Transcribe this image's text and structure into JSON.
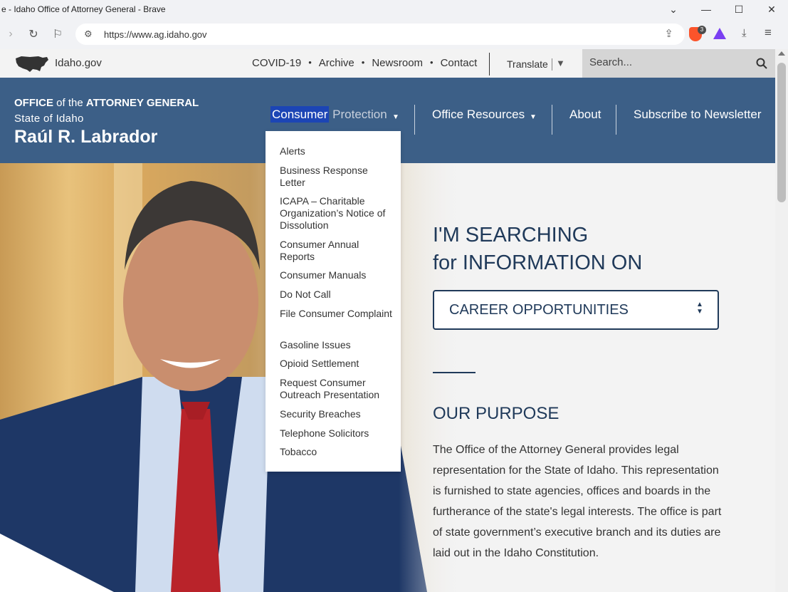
{
  "browser": {
    "window_title": "e - Idaho Office of Attorney General - Brave",
    "url": "https://www.ag.idaho.gov",
    "brave_badge_count": "3"
  },
  "utility_bar": {
    "idaho_link": "Idaho.gov",
    "links": [
      "COVID-19",
      "Archive",
      "Newsroom",
      "Contact"
    ],
    "separator": "•",
    "translate": "Translate",
    "search_placeholder": "Search..."
  },
  "header": {
    "org_line1_bold1": "OFFICE",
    "org_line1_mid": " of the ",
    "org_line1_bold2": "ATTORNEY GENERAL",
    "org_line2": "State of Idaho",
    "ag_name": "Raúl R. Labrador"
  },
  "nav": {
    "consumer_highlight": "Consumer",
    "consumer_rest": " Protection",
    "office_resources": "Office Resources",
    "about": "About",
    "subscribe": "Subscribe to Newsletter",
    "caret": "▼"
  },
  "dropdown": {
    "items": [
      "Alerts",
      "Business Response Letter",
      "ICAPA – Charitable Organization’s Notice of Dissolution",
      "Consumer Annual Reports",
      "Consumer Manuals",
      "Do Not Call",
      "File Consumer Complaint",
      "Gasoline Issues",
      "Opioid Settlement",
      "Request Consumer Outreach Presentation",
      "Security Breaches",
      "Telephone Solicitors",
      "Tobacco"
    ]
  },
  "hero": {
    "searching_line1": "I'M SEARCHING",
    "searching_line2": "for INFORMATION ON",
    "select_value": "CAREER OPPORTUNITIES",
    "purpose_heading": "OUR PURPOSE",
    "purpose_text": "The Office of the Attorney General provides legal representation for the State of Idaho. This representation is furnished to state agencies, offices and boards in the furtherance of the state's legal interests. The office is part of state government’s executive branch and its duties are laid out in the Idaho Constitution."
  }
}
